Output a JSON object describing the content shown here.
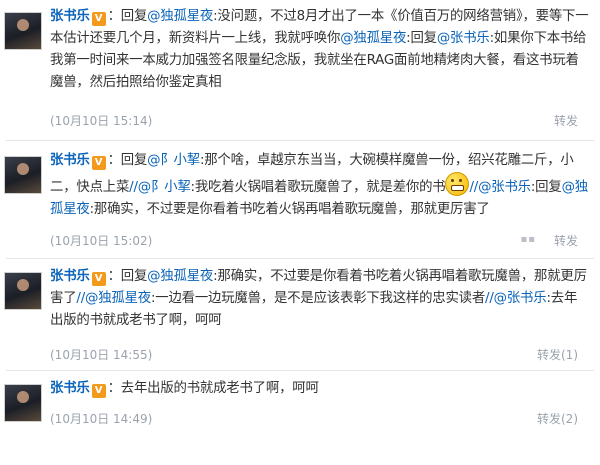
{
  "posts": [
    {
      "author": "张书乐",
      "text_before_at": "回复",
      "at1": "@独孤星夜",
      "text_after_at": ":没问题，不过8月才出了一本《价值百万的网络营销》，要等下一本估计还要几个月，新资料片一上线，我就呼唤你",
      "at2": "@独孤星夜",
      "text_mid": ":回复",
      "at3": "@张书乐",
      "text_end": ":如果你下本书给我第一时间来一本威力加强签名限量纪念版，我就坐在RAG面前地精烤肉大餐，看这书玩着魔兽，然后拍照给你鉴定真相",
      "time": "(10月10日 15:14)",
      "repost": "转发"
    },
    {
      "author": "张书乐",
      "text_before_at": "回复",
      "at1": "@阝小挈",
      "text_after_at": ":那个啥，卓越京东当当，大碗模样魔兽一份，绍兴花雕二斤，小二，快点上菜",
      "at2": "//@阝小挈",
      "text_mid": ":我吃着火锅唱着歌玩魔兽了，就是差你的书",
      "at3": "//@张书乐",
      "text_end": ":回复",
      "at4": "@独孤星夜",
      "text_tail": ":那确实，不过要是你看着书吃着火锅再唱着歌玩魔兽，那就更厉害了",
      "time": "(10月10日 15:02)",
      "repost": "转发"
    },
    {
      "author": "张书乐",
      "text_before_at": "回复",
      "at1": "@独孤星夜",
      "text_after_at": ":那确实，不过要是你看着书吃着火锅再唱着歌玩魔兽，那就更厉害了",
      "at2": "//@独孤星夜",
      "text_mid": ":一边看一边玩魔兽，是不是应该表彰下我这样的忠实读者",
      "at3": "//@张书乐",
      "text_end": ":去年出版的书就成老书了啊，呵呵",
      "time": "(10月10日 14:55)",
      "repost": "转发(1)"
    },
    {
      "author": "张书乐",
      "text": "去年出版的书就成老书了啊，呵呵",
      "time": "(10月10日 14:49)",
      "repost": "转发(2)"
    }
  ],
  "badge": "V"
}
